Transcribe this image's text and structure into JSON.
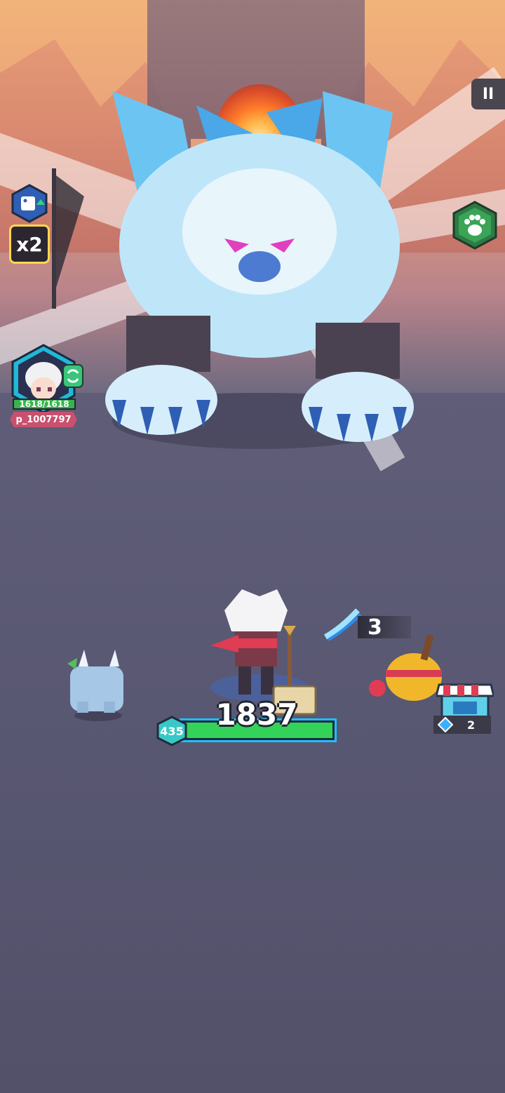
{
  "hud": {
    "pause_label": "II",
    "speed_label": "x2",
    "player_hp": "1618/1618",
    "player_name": "p_1007797"
  },
  "battle": {
    "hero_hp_value": "1837",
    "hero_hp_fraction": 1.0,
    "hero_level": "435",
    "damage_combo": "3",
    "gem_count": "2"
  },
  "colors": {
    "hp_green": "#33d35a",
    "hp_border": "#1ec0ff",
    "name_tag": "#c9506e",
    "x2_border": "#ffd84a"
  },
  "icons": {
    "pause": "pause-icon",
    "speed_boost": "dice-speed-icon",
    "pet": "paw-icon",
    "refresh": "swap-icon",
    "gem": "blue-gem-icon",
    "shop": "shop-stall-icon",
    "damage": "slash-icon"
  }
}
